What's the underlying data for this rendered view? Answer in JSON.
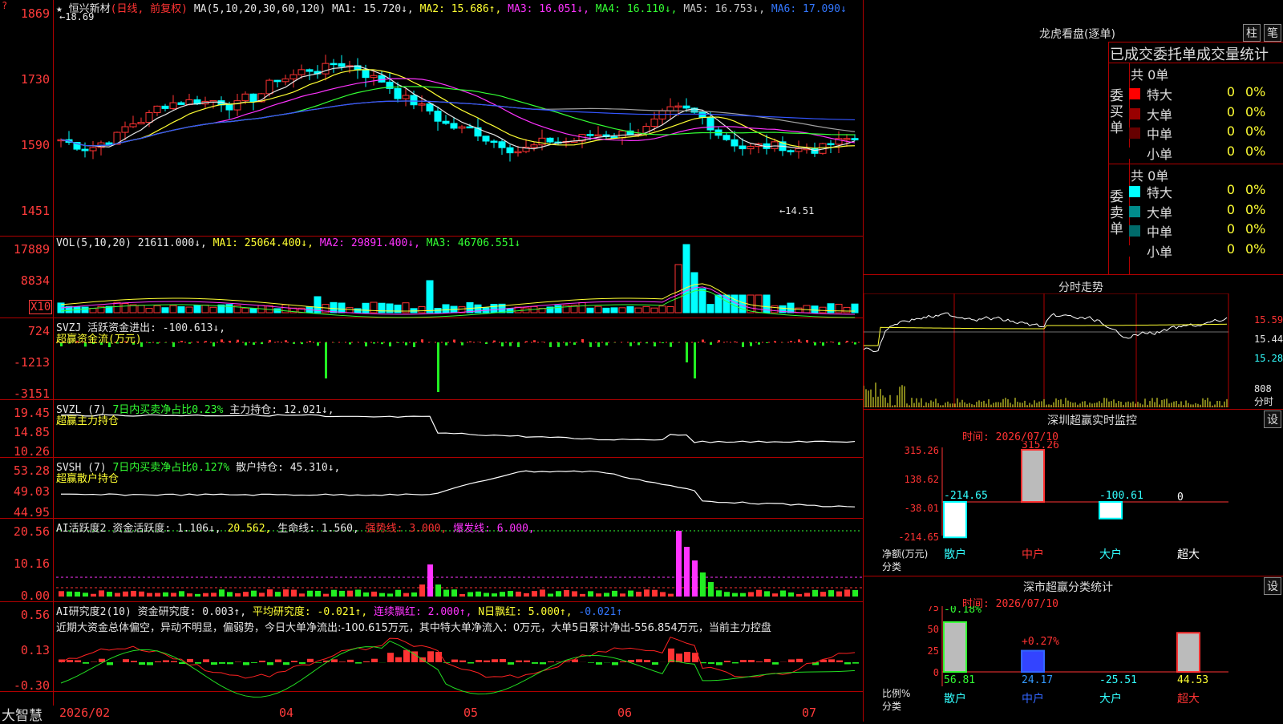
{
  "stock": {
    "name": "恒兴新材",
    "mode": "(日线, 前复权)",
    "star": "★",
    "quote": "?",
    "high_marker": "←18.69",
    "low_marker": "←14.51"
  },
  "ma_header": {
    "label": "MA(5,10,20,30,60,120)",
    "items": [
      {
        "text": "MA1: 15.720↓,",
        "color": "#e6e6e6"
      },
      {
        "text": "MA2: 15.686↑,",
        "color": "#ffff33"
      },
      {
        "text": "MA3: 16.051↓,",
        "color": "#ff33ff"
      },
      {
        "text": "MA4: 16.110↓,",
        "color": "#33ff33"
      },
      {
        "text": "MA5: 16.753↓,",
        "color": "#c8c8c8"
      },
      {
        "text": "MA6: 17.090↓",
        "color": "#3377ff"
      }
    ]
  },
  "price_axis": [
    "1869",
    "1730",
    "1590",
    "1451"
  ],
  "vol_header": {
    "label": "VOL(5,10,20)",
    "value": "21611.000↓,",
    "ma1": "MA1: 25064.400↓,",
    "ma2": "MA2: 29891.400↓,",
    "ma3": "MA3: 46706.551↓"
  },
  "vol_axis": [
    "17889",
    "8834",
    "X10"
  ],
  "svzj": {
    "label": "SVZJ",
    "text": "活跃资金进出: -100.613↓,",
    "sub": "超赢资金流(万元)",
    "axis": [
      "724",
      "-1213",
      "-3151"
    ]
  },
  "svzl": {
    "label": "SVZL (7)",
    "ratio": "7日内买卖净占比0.23%",
    "hold": "主力持仓: 12.021↓,",
    "sub": "超赢主力持仓",
    "axis": [
      "19.45",
      "14.85",
      "10.26"
    ]
  },
  "svsh": {
    "label": "SVSH (7)",
    "ratio": "7日内买卖净占比0.127%",
    "hold": "散户持仓: 45.310↓,",
    "sub": "超赢散户持仓",
    "axis": [
      "53.28",
      "49.03",
      "44.95"
    ]
  },
  "ai_active": {
    "label": "AI活跃度2",
    "v1": "资金活跃度: 1.106↓,",
    "v2": "20.562,",
    "v3": "生命线: 1.560,",
    "v4": "强势线: 3.000,",
    "v5": "爆发线: 6.000,",
    "axis": [
      "20.56",
      "10.16",
      "0.00"
    ]
  },
  "ai_research": {
    "label": "AI研究度2(10)",
    "v1": "资金研究度: 0.003↑,",
    "v2": "平均研究度: -0.021↑,",
    "v3": "连续飘红: 2.000↑,",
    "v4": "N日飘红: 5.000↑,",
    "v5": "-0.021↑",
    "comment": "近期大资金总体偏空，异动不明显，偏弱势，今日大单净流出:-100.615万元，其中特大单净流入：0万元，大单5日累计净出-556.854万元，当前主力控盘",
    "axis": [
      "0.56",
      "0.13",
      "-0.30"
    ]
  },
  "x_axis": {
    "brand": "大智慧",
    "labels": [
      "2026/02",
      "04",
      "05",
      "06",
      "07"
    ]
  },
  "dragon": {
    "title": "龙虎看盘(逐单)",
    "btn1": "柱",
    "btn2": "笔",
    "subtitle": "已成交委托单成交量统计",
    "buy": {
      "side": "委买单",
      "total": "共 0单",
      "rows": [
        {
          "label": "特大",
          "val": "0",
          "pct": "0%",
          "color": "#ff0000"
        },
        {
          "label": "大单",
          "val": "0",
          "pct": "0%",
          "color": "#990000"
        },
        {
          "label": "中单",
          "val": "0",
          "pct": "0%",
          "color": "#660000"
        },
        {
          "label": "小单",
          "val": "0",
          "pct": "0%",
          "color": "#000000"
        }
      ]
    },
    "sell": {
      "side": "委卖单",
      "total": "共 0单",
      "rows": [
        {
          "label": "特大",
          "val": "0",
          "pct": "0%",
          "color": "#00ffff"
        },
        {
          "label": "大单",
          "val": "0",
          "pct": "0%",
          "color": "#008b8b"
        },
        {
          "label": "中单",
          "val": "0",
          "pct": "0%",
          "color": "#006b6b"
        },
        {
          "label": "小单",
          "val": "0",
          "pct": "0%",
          "color": "#000000"
        }
      ]
    }
  },
  "intraday": {
    "title": "分时走势",
    "price_axis": [
      "15.59",
      "15.44",
      "15.28"
    ],
    "vol_axis": [
      "808",
      "分时"
    ]
  },
  "monitor": {
    "title": "深圳超赢实时监控",
    "btn": "设",
    "time": "时间: 2026/07/10",
    "axis": [
      "315.26",
      "138.62",
      "-38.01",
      "-214.65"
    ],
    "axis_label1": "净额(万元)",
    "axis_label2": "分类",
    "categories": [
      "散户",
      "中户",
      "大户",
      "超大"
    ],
    "values": [
      -214.65,
      315.26,
      -100.61,
      0
    ],
    "value_labels": [
      "-214.65",
      "315.26",
      "-100.61",
      "0"
    ]
  },
  "classify": {
    "title": "深市超赢分类统计",
    "btn": "设",
    "time": "时间: 2026/07/10",
    "axis": [
      "75",
      "50",
      "25",
      "0"
    ],
    "axis_label1": "比例%",
    "axis_label2": "分类",
    "categories": [
      "散户",
      "中户",
      "大户",
      "超大"
    ],
    "values": [
      56.81,
      24.17,
      -25.51,
      44.53
    ],
    "value_labels": [
      "56.81",
      "24.17",
      "-25.51",
      "44.53"
    ],
    "change_labels": [
      "-0.18%",
      "+0.27%"
    ]
  },
  "colors": {
    "up": "#ff3333",
    "down": "#00ffff",
    "grid": "#b00000",
    "ma1": "#e6e6e6",
    "ma2": "#ffff33",
    "ma3": "#ff33ff",
    "ma4": "#33ff33",
    "ma6": "#3355ff"
  }
}
